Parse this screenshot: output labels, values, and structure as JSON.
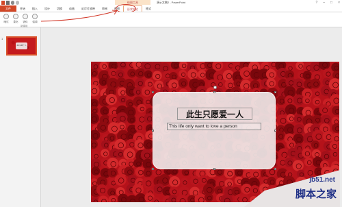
{
  "window": {
    "title": "演示文稿2 - PowerPoint",
    "contextual_group": "绘图工具"
  },
  "tabs": [
    "文件",
    "开始",
    "插入",
    "设计",
    "切换",
    "动画",
    "幻灯片放映",
    "审阅",
    "视图",
    "形状格式",
    "格式"
  ],
  "active_tab": "形状格式",
  "ribbon": {
    "buttons": [
      "暗沉",
      "柔化",
      "锐化",
      "强调"
    ],
    "group_label": "新建组"
  },
  "thumbnail": {
    "number": "1",
    "text": "此生只愿爱一人"
  },
  "slide": {
    "title": "此生只愿爱一人",
    "subtitle": "This life only want to love a person"
  },
  "watermark": {
    "domain": "jb51.net",
    "chinese": "脚本之家"
  },
  "colors": {
    "file_tab": "#d24726",
    "annotation": "#d33b2c",
    "rose": "#b5121a",
    "watermark": "#2b3a8c"
  }
}
